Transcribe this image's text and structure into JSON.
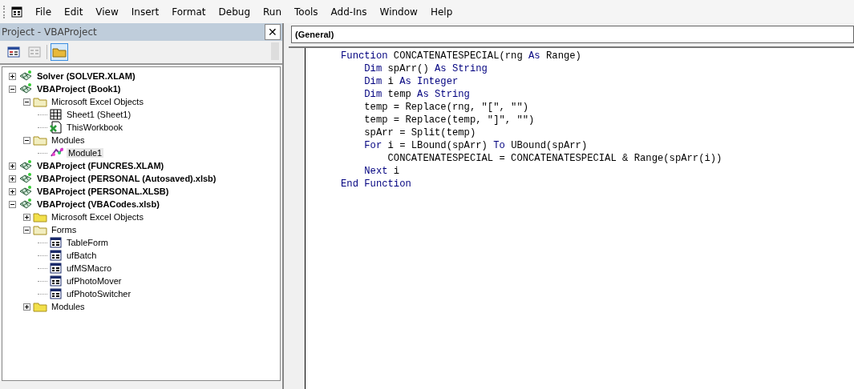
{
  "menu": [
    "File",
    "Edit",
    "View",
    "Insert",
    "Format",
    "Debug",
    "Run",
    "Tools",
    "Add-Ins",
    "Window",
    "Help"
  ],
  "project_panel": {
    "title": "Project - VBAProject",
    "close": "✕",
    "toolbar": [
      {
        "kind": "view-code",
        "selected": false
      },
      {
        "kind": "view-object",
        "selected": false
      },
      {
        "kind": "toggle-folders",
        "selected": true
      }
    ],
    "tree": [
      {
        "label": "Solver (SOLVER.XLAM)",
        "kind": "project",
        "expanded": false,
        "selected": false
      },
      {
        "label": "VBAProject (Book1)",
        "kind": "project",
        "expanded": true,
        "selected": false,
        "children": [
          {
            "label": "Microsoft Excel Objects",
            "kind": "folder",
            "expanded": true,
            "selected": false,
            "children": [
              {
                "label": "Sheet1 (Sheet1)",
                "kind": "sheet",
                "selected": false
              },
              {
                "label": "ThisWorkbook",
                "kind": "workbook",
                "selected": false
              }
            ]
          },
          {
            "label": "Modules",
            "kind": "folder",
            "expanded": true,
            "selected": false,
            "children": [
              {
                "label": "Module1",
                "kind": "module",
                "selected": true
              }
            ]
          }
        ]
      },
      {
        "label": "VBAProject (FUNCRES.XLAM)",
        "kind": "project",
        "expanded": false,
        "selected": false
      },
      {
        "label": "VBAProject (PERSONAL (Autosaved).xlsb)",
        "kind": "project",
        "expanded": false,
        "selected": false
      },
      {
        "label": "VBAProject (PERSONAL.XLSB)",
        "kind": "project",
        "expanded": false,
        "selected": false
      },
      {
        "label": "VBAProject (VBACodes.xlsb)",
        "kind": "project",
        "expanded": true,
        "selected": false,
        "children": [
          {
            "label": "Microsoft Excel Objects",
            "kind": "folder",
            "expanded": false,
            "selected": false
          },
          {
            "label": "Forms",
            "kind": "folder",
            "expanded": true,
            "selected": false,
            "children": [
              {
                "label": "TableForm",
                "kind": "form",
                "selected": false
              },
              {
                "label": "ufBatch",
                "kind": "form",
                "selected": false
              },
              {
                "label": "ufMSMacro",
                "kind": "form",
                "selected": false
              },
              {
                "label": "ufPhotoMover",
                "kind": "form",
                "selected": false
              },
              {
                "label": "ufPhotoSwitcher",
                "kind": "form",
                "selected": false
              }
            ]
          },
          {
            "label": "Modules",
            "kind": "folder",
            "expanded": false,
            "selected": false
          }
        ]
      }
    ]
  },
  "code_window": {
    "object_box": "(General)",
    "lines": [
      {
        "tokens": [
          {
            "text": "Function",
            "kind": "keyword"
          },
          {
            "text": " CONCATENATESPECIAL(rng ",
            "kind": "plain"
          },
          {
            "text": "As",
            "kind": "keyword"
          },
          {
            "text": " Range)",
            "kind": "plain"
          }
        ]
      },
      {
        "tokens": [
          {
            "text": "    Dim",
            "kind": "keyword"
          },
          {
            "text": " spArr() ",
            "kind": "plain"
          },
          {
            "text": "As String",
            "kind": "keyword"
          }
        ]
      },
      {
        "tokens": [
          {
            "text": "    Dim",
            "kind": "keyword"
          },
          {
            "text": " i ",
            "kind": "plain"
          },
          {
            "text": "As Integer",
            "kind": "keyword"
          }
        ]
      },
      {
        "tokens": [
          {
            "text": "    Dim",
            "kind": "keyword"
          },
          {
            "text": " temp ",
            "kind": "plain"
          },
          {
            "text": "As String",
            "kind": "keyword"
          }
        ]
      },
      {
        "tokens": [
          {
            "text": "    temp = Replace(rng, \"[\", \"\")",
            "kind": "plain"
          }
        ]
      },
      {
        "tokens": [
          {
            "text": "    temp = Replace(temp, \"]\", \"\")",
            "kind": "plain"
          }
        ]
      },
      {
        "tokens": [
          {
            "text": "    spArr = Split(temp)",
            "kind": "plain"
          }
        ]
      },
      {
        "tokens": [
          {
            "text": "    For",
            "kind": "keyword"
          },
          {
            "text": " i = LBound(spArr) ",
            "kind": "plain"
          },
          {
            "text": "To",
            "kind": "keyword"
          },
          {
            "text": " UBound(spArr)",
            "kind": "plain"
          }
        ]
      },
      {
        "tokens": [
          {
            "text": "        CONCATENATESPECIAL = CONCATENATESPECIAL & Range(spArr(i))",
            "kind": "plain"
          }
        ]
      },
      {
        "tokens": [
          {
            "text": "    Next",
            "kind": "keyword"
          },
          {
            "text": " i",
            "kind": "plain"
          }
        ]
      },
      {
        "tokens": [
          {
            "text": "End Function",
            "kind": "keyword"
          }
        ]
      }
    ]
  }
}
